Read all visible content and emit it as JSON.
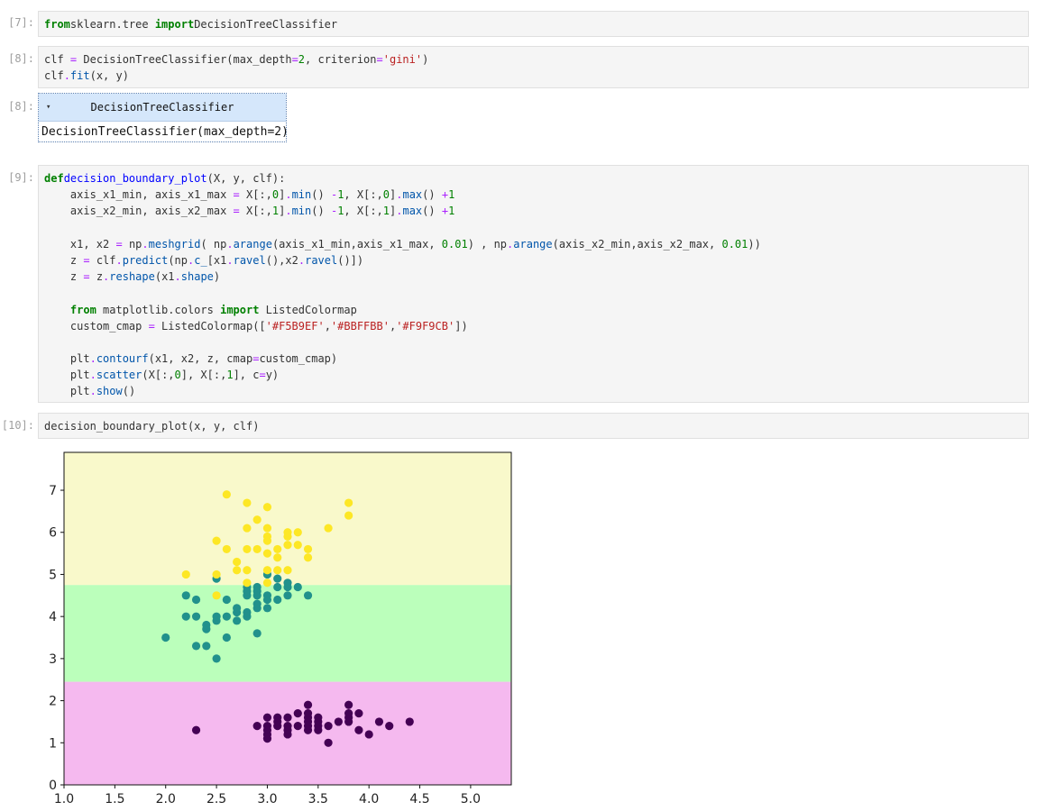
{
  "cells": [
    {
      "prompt": "[7]:",
      "lines": [
        [
          [
            "kw",
            "from"
          ],
          [
            "",
            "sklearn.tree "
          ],
          [
            "kw",
            "import"
          ],
          [
            "",
            "DecisionTreeClassifier"
          ]
        ]
      ]
    },
    {
      "prompt": "[8]:",
      "lines": [
        [
          [
            "",
            "clf "
          ],
          [
            "op",
            "="
          ],
          [
            "",
            " DecisionTreeClassifier(max_depth"
          ],
          [
            "op",
            "="
          ],
          [
            "num",
            "2"
          ],
          [
            "",
            ", criterion"
          ],
          [
            "op",
            "="
          ],
          [
            "str",
            "'gini'"
          ],
          [
            "",
            ")"
          ]
        ],
        [
          [
            "",
            "clf"
          ],
          [
            "op",
            "."
          ],
          [
            "attr",
            "fit"
          ],
          [
            "",
            "(x, y)"
          ]
        ]
      ]
    },
    {
      "prompt": "[9]:",
      "lines": [
        [
          [
            "kw",
            "def"
          ],
          [
            "",
            ""
          ],
          [
            "fn",
            "decision_boundary_plot"
          ],
          [
            "",
            "(X, y, clf):"
          ]
        ],
        [
          [
            "",
            "    axis_x1_min, axis_x1_max "
          ],
          [
            "op",
            "="
          ],
          [
            "",
            " X[:,"
          ],
          [
            "num",
            "0"
          ],
          [
            "",
            "]"
          ],
          [
            "op",
            "."
          ],
          [
            "attr",
            "min"
          ],
          [
            "",
            "() "
          ],
          [
            "op",
            "-"
          ],
          [
            "",
            ""
          ],
          [
            "num",
            "1"
          ],
          [
            "",
            ", X[:,"
          ],
          [
            "num",
            "0"
          ],
          [
            "",
            "]"
          ],
          [
            "op",
            "."
          ],
          [
            "attr",
            "max"
          ],
          [
            "",
            "() "
          ],
          [
            "op",
            "+"
          ],
          [
            "",
            ""
          ],
          [
            "num",
            "1"
          ]
        ],
        [
          [
            "",
            "    axis_x2_min, axis_x2_max "
          ],
          [
            "op",
            "="
          ],
          [
            "",
            " X[:,"
          ],
          [
            "num",
            "1"
          ],
          [
            "",
            "]"
          ],
          [
            "op",
            "."
          ],
          [
            "attr",
            "min"
          ],
          [
            "",
            "() "
          ],
          [
            "op",
            "-"
          ],
          [
            "",
            ""
          ],
          [
            "num",
            "1"
          ],
          [
            "",
            ", X[:,"
          ],
          [
            "num",
            "1"
          ],
          [
            "",
            "]"
          ],
          [
            "op",
            "."
          ],
          [
            "attr",
            "max"
          ],
          [
            "",
            "() "
          ],
          [
            "op",
            "+"
          ],
          [
            "",
            ""
          ],
          [
            "num",
            "1"
          ]
        ],
        [],
        [
          [
            "",
            "    x1, x2 "
          ],
          [
            "op",
            "="
          ],
          [
            "",
            " np"
          ],
          [
            "op",
            "."
          ],
          [
            "attr",
            "meshgrid"
          ],
          [
            "",
            "( np"
          ],
          [
            "op",
            "."
          ],
          [
            "attr",
            "arange"
          ],
          [
            "",
            "(axis_x1_min,axis_x1_max, "
          ],
          [
            "num",
            "0.01"
          ],
          [
            "",
            ") , np"
          ],
          [
            "op",
            "."
          ],
          [
            "attr",
            "arange"
          ],
          [
            "",
            "(axis_x2_min,axis_x2_max, "
          ],
          [
            "num",
            "0.01"
          ],
          [
            "",
            "))"
          ]
        ],
        [
          [
            "",
            "    z "
          ],
          [
            "op",
            "="
          ],
          [
            "",
            " clf"
          ],
          [
            "op",
            "."
          ],
          [
            "attr",
            "predict"
          ],
          [
            "",
            "(np"
          ],
          [
            "op",
            "."
          ],
          [
            "attr",
            "c_"
          ],
          [
            "",
            "[x1"
          ],
          [
            "op",
            "."
          ],
          [
            "attr",
            "ravel"
          ],
          [
            "",
            "(),x2"
          ],
          [
            "op",
            "."
          ],
          [
            "attr",
            "ravel"
          ],
          [
            "",
            "()])"
          ]
        ],
        [
          [
            "",
            "    z "
          ],
          [
            "op",
            "="
          ],
          [
            "",
            " z"
          ],
          [
            "op",
            "."
          ],
          [
            "attr",
            "reshape"
          ],
          [
            "",
            "(x1"
          ],
          [
            "op",
            "."
          ],
          [
            "attr",
            "shape"
          ],
          [
            "",
            ")"
          ]
        ],
        [],
        [
          [
            "",
            "    "
          ],
          [
            "kw",
            "from"
          ],
          [
            "",
            " matplotlib.colors "
          ],
          [
            "kw",
            "import"
          ],
          [
            "",
            " ListedColormap"
          ]
        ],
        [
          [
            "",
            "    custom_cmap "
          ],
          [
            "op",
            "="
          ],
          [
            "",
            " ListedColormap(["
          ],
          [
            "str",
            "'#F5B9EF'"
          ],
          [
            "",
            ","
          ],
          [
            "str",
            "'#BBFFBB'"
          ],
          [
            "",
            ","
          ],
          [
            "str",
            "'#F9F9CB'"
          ],
          [
            "",
            "])"
          ]
        ],
        [],
        [
          [
            "",
            "    plt"
          ],
          [
            "op",
            "."
          ],
          [
            "attr",
            "contourf"
          ],
          [
            "",
            "(x1, x2, z, cmap"
          ],
          [
            "op",
            "="
          ],
          [
            "",
            "custom_cmap)"
          ]
        ],
        [
          [
            "",
            "    plt"
          ],
          [
            "op",
            "."
          ],
          [
            "attr",
            "scatter"
          ],
          [
            "",
            "(X[:,"
          ],
          [
            "num",
            "0"
          ],
          [
            "",
            "], X[:,"
          ],
          [
            "num",
            "1"
          ],
          [
            "",
            "], c"
          ],
          [
            "op",
            "="
          ],
          [
            "",
            "y)"
          ]
        ],
        [
          [
            "",
            "    plt"
          ],
          [
            "op",
            "."
          ],
          [
            "attr",
            "show"
          ],
          [
            "",
            "()"
          ]
        ]
      ]
    },
    {
      "prompt": "[10]:",
      "lines": [
        [
          [
            "",
            "decision_boundary_plot(x, y, clf)"
          ]
        ]
      ]
    }
  ],
  "output8": {
    "prompt": "[8]:",
    "arrow": "▾",
    "title": "DecisionTreeClassifier",
    "repr": "DecisionTreeClassifier(max_depth=2)"
  },
  "colors": {
    "region0": "#F5B9EF",
    "region1": "#BBFFBB",
    "region2": "#F9F9CB",
    "class0": "#440154",
    "class1": "#21918c",
    "class2": "#fde725"
  },
  "chart_data": {
    "type": "scatter",
    "xlim": [
      1.0,
      5.4
    ],
    "ylim": [
      0,
      7.9
    ],
    "xticks": [
      "1.0",
      "1.5",
      "2.0",
      "2.5",
      "3.0",
      "3.5",
      "4.0",
      "4.5",
      "5.0"
    ],
    "yticks": [
      "0",
      "1",
      "2",
      "3",
      "4",
      "5",
      "6",
      "7"
    ],
    "grid": false,
    "regions": [
      {
        "class": 0,
        "y_from": 0,
        "y_to": 2.45
      },
      {
        "class": 1,
        "y_from": 2.45,
        "y_to": 4.75
      },
      {
        "class": 2,
        "y_from": 4.75,
        "y_to": 7.9
      }
    ],
    "series": [
      {
        "class": 0,
        "points": [
          [
            2.3,
            1.3
          ],
          [
            2.9,
            1.4
          ],
          [
            3.0,
            1.1
          ],
          [
            3.0,
            1.2
          ],
          [
            3.0,
            1.3
          ],
          [
            3.0,
            1.4
          ],
          [
            3.0,
            1.6
          ],
          [
            3.1,
            1.4
          ],
          [
            3.1,
            1.5
          ],
          [
            3.1,
            1.6
          ],
          [
            3.2,
            1.2
          ],
          [
            3.2,
            1.3
          ],
          [
            3.2,
            1.4
          ],
          [
            3.2,
            1.6
          ],
          [
            3.3,
            1.4
          ],
          [
            3.3,
            1.7
          ],
          [
            3.4,
            1.3
          ],
          [
            3.4,
            1.4
          ],
          [
            3.4,
            1.5
          ],
          [
            3.4,
            1.6
          ],
          [
            3.4,
            1.7
          ],
          [
            3.4,
            1.9
          ],
          [
            3.5,
            1.3
          ],
          [
            3.5,
            1.4
          ],
          [
            3.5,
            1.5
          ],
          [
            3.5,
            1.6
          ],
          [
            3.6,
            1.0
          ],
          [
            3.6,
            1.4
          ],
          [
            3.7,
            1.5
          ],
          [
            3.8,
            1.5
          ],
          [
            3.8,
            1.6
          ],
          [
            3.8,
            1.7
          ],
          [
            3.8,
            1.9
          ],
          [
            3.9,
            1.3
          ],
          [
            3.9,
            1.7
          ],
          [
            4.0,
            1.2
          ],
          [
            4.1,
            1.5
          ],
          [
            4.2,
            1.4
          ],
          [
            4.4,
            1.5
          ]
        ]
      },
      {
        "class": 1,
        "points": [
          [
            2.0,
            3.5
          ],
          [
            2.2,
            4.0
          ],
          [
            2.2,
            4.5
          ],
          [
            2.3,
            3.3
          ],
          [
            2.3,
            4.0
          ],
          [
            2.3,
            4.4
          ],
          [
            2.4,
            3.3
          ],
          [
            2.4,
            3.7
          ],
          [
            2.4,
            3.8
          ],
          [
            2.5,
            3.0
          ],
          [
            2.5,
            3.9
          ],
          [
            2.5,
            4.0
          ],
          [
            2.5,
            4.9
          ],
          [
            2.6,
            3.5
          ],
          [
            2.6,
            4.0
          ],
          [
            2.6,
            4.4
          ],
          [
            2.7,
            3.9
          ],
          [
            2.7,
            4.1
          ],
          [
            2.7,
            4.2
          ],
          [
            2.8,
            4.0
          ],
          [
            2.8,
            4.1
          ],
          [
            2.8,
            4.5
          ],
          [
            2.8,
            4.6
          ],
          [
            2.8,
            4.7
          ],
          [
            2.9,
            3.6
          ],
          [
            2.9,
            4.2
          ],
          [
            2.9,
            4.3
          ],
          [
            2.9,
            4.5
          ],
          [
            2.9,
            4.6
          ],
          [
            2.9,
            4.7
          ],
          [
            3.0,
            4.2
          ],
          [
            3.0,
            4.4
          ],
          [
            3.0,
            4.5
          ],
          [
            3.0,
            5.0
          ],
          [
            3.1,
            4.4
          ],
          [
            3.1,
            4.7
          ],
          [
            3.1,
            4.9
          ],
          [
            3.2,
            4.5
          ],
          [
            3.2,
            4.7
          ],
          [
            3.2,
            4.8
          ],
          [
            3.3,
            4.7
          ],
          [
            3.4,
            4.5
          ]
        ]
      },
      {
        "class": 2,
        "points": [
          [
            2.2,
            5.0
          ],
          [
            2.5,
            4.5
          ],
          [
            2.5,
            5.0
          ],
          [
            2.5,
            5.8
          ],
          [
            2.6,
            5.6
          ],
          [
            2.6,
            6.9
          ],
          [
            2.7,
            5.1
          ],
          [
            2.7,
            5.3
          ],
          [
            2.8,
            4.8
          ],
          [
            2.8,
            5.1
          ],
          [
            2.8,
            5.6
          ],
          [
            2.8,
            6.1
          ],
          [
            2.8,
            6.7
          ],
          [
            2.9,
            5.6
          ],
          [
            2.9,
            6.3
          ],
          [
            3.0,
            4.8
          ],
          [
            3.0,
            5.1
          ],
          [
            3.0,
            5.5
          ],
          [
            3.0,
            5.8
          ],
          [
            3.0,
            5.9
          ],
          [
            3.0,
            6.1
          ],
          [
            3.0,
            6.6
          ],
          [
            3.1,
            5.1
          ],
          [
            3.1,
            5.4
          ],
          [
            3.1,
            5.6
          ],
          [
            3.2,
            5.1
          ],
          [
            3.2,
            5.7
          ],
          [
            3.2,
            5.9
          ],
          [
            3.2,
            6.0
          ],
          [
            3.3,
            5.7
          ],
          [
            3.3,
            6.0
          ],
          [
            3.4,
            5.4
          ],
          [
            3.4,
            5.6
          ],
          [
            3.6,
            6.1
          ],
          [
            3.8,
            6.4
          ],
          [
            3.8,
            6.7
          ]
        ]
      }
    ]
  }
}
